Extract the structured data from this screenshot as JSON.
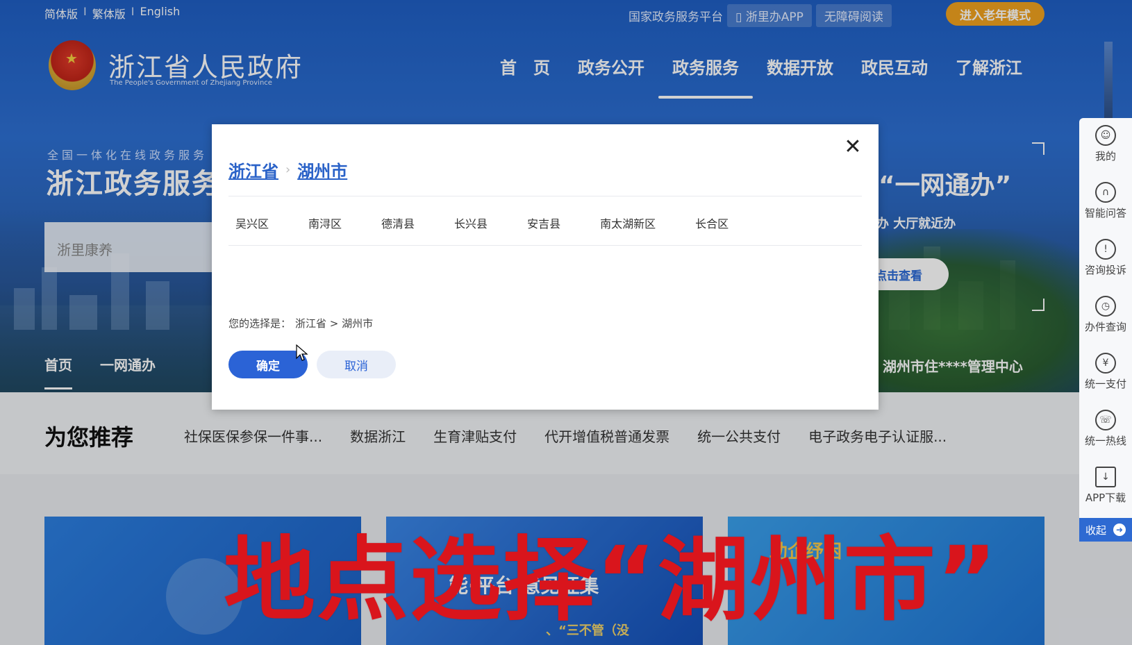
{
  "topbar": {
    "lang": [
      "简体版",
      "繁体版",
      "English"
    ],
    "links": [
      "国家政务服务平台",
      "浙里办APP",
      "无障碍阅读"
    ],
    "elder_mode": "进入老年模式"
  },
  "logo": {
    "title": "浙江省人民政府",
    "subtitle": "The People's Government of Zhejiang Province"
  },
  "mainnav": [
    "首　页",
    "政务公开",
    "政务服务",
    "数据开放",
    "政民互动",
    "了解浙江"
  ],
  "hero": {
    "tag": "全国一体化在线政务服务",
    "title": "浙江政务服务",
    "search_placeholder": "浙里康养",
    "right_title": "“一网通办”",
    "right_sub": "办 大厅就近办",
    "right_btn": "点击查看",
    "right_foot": "湖州市住****管理中心"
  },
  "subnav": [
    "首页",
    "一网通办"
  ],
  "recommend": {
    "heading": "为您推荐",
    "links": [
      "社保医保参保一件事...",
      "数据浙江",
      "生育津贴支付",
      "代开增值税普通发票",
      "统一公共支付",
      "电子政务电子认证服..."
    ]
  },
  "cards": {
    "card2_title": "能·平台   意见征集",
    "card2_sub": "、“三不管（没",
    "card3_title": "助企纾困"
  },
  "sidetool": [
    "我的",
    "智能问答",
    "咨询投诉",
    "办件查询",
    "统一支付",
    "统一热线",
    "APP下载"
  ],
  "sidetool_icons": [
    "user-icon",
    "headset-icon",
    "alert-icon",
    "clock-icon",
    "yuan-icon",
    "phone-icon",
    "download-icon"
  ],
  "sidetool_collapse": "收起",
  "modal": {
    "crumb_province": "浙江省",
    "crumb_city": "湖州市",
    "districts": [
      "吴兴区",
      "南浔区",
      "德清县",
      "长兴县",
      "安吉县",
      "南太湖新区",
      "长合区"
    ],
    "choice_label": "您的选择是：",
    "choice_value": "浙江省 > 湖州市",
    "ok": "确定",
    "cancel": "取消"
  },
  "caption": "地点选择“湖州市”",
  "colors": {
    "primary": "#2b63d6",
    "elder": "#f0a21f",
    "caption": "#d9151c"
  }
}
